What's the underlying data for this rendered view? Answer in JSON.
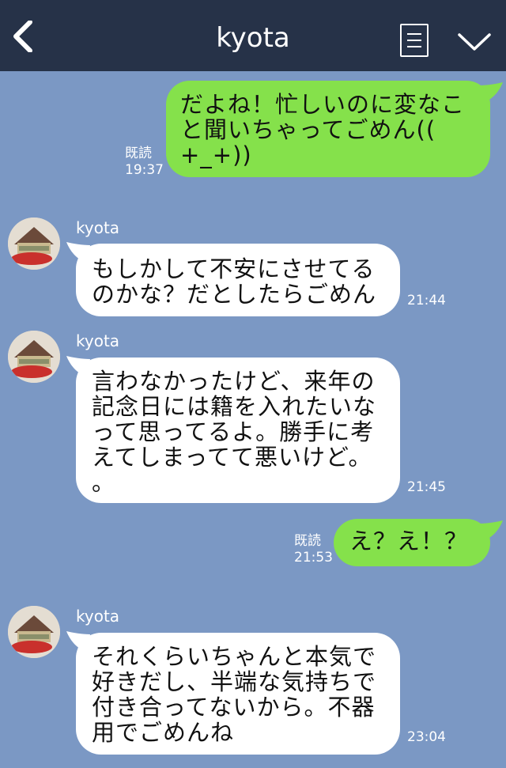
{
  "header": {
    "back_icon": "chevron-left-icon",
    "title": "kyota",
    "menu_icon": "note-menu-icon",
    "collapse_icon": "chevron-down-icon"
  },
  "colors": {
    "background": "#7b98c4",
    "header": "#263248",
    "outgoing_bubble": "#85e14b",
    "incoming_bubble": "#ffffff"
  },
  "messages": [
    {
      "direction": "outgoing",
      "text": "だよね！忙しいのに変なこ\nと聞いちゃってごめん((\n+_+))",
      "read_label": "既読",
      "time": "19:37"
    },
    {
      "direction": "incoming",
      "sender": "kyota",
      "text": "もしかして不安にさせてる\nのかな？だとしたらごめん",
      "time": "21:44"
    },
    {
      "direction": "incoming",
      "sender": "kyota",
      "text": "言わなかったけど、来年の\n記念日には籍を入れたいな\nって思ってるよ。勝手に考\nえてしまってて悪いけど。\n。",
      "time": "21:45"
    },
    {
      "direction": "outgoing",
      "text": "え？え！？",
      "read_label": "既読",
      "time": "21:53"
    },
    {
      "direction": "incoming",
      "sender": "kyota",
      "text": "それくらいちゃんと本気で\n好きだし、半端な気持ちで\n付き合ってないから。不器\n用でごめんね",
      "time": "23:04"
    }
  ]
}
